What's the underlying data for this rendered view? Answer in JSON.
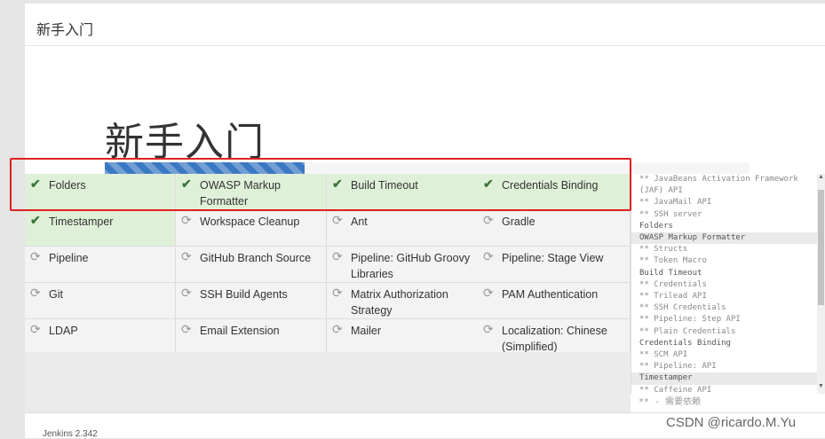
{
  "window": {
    "title": "新手入门"
  },
  "hero": {
    "title": "新手入门",
    "progress_fraction": 0.31
  },
  "plugins": [
    {
      "name": "Folders",
      "status": "done"
    },
    {
      "name": "OWASP Markup Formatter",
      "status": "done"
    },
    {
      "name": "Build Timeout",
      "status": "done"
    },
    {
      "name": "Credentials Binding",
      "status": "done"
    },
    {
      "name": "Timestamper",
      "status": "done"
    },
    {
      "name": "Workspace Cleanup",
      "status": "pending"
    },
    {
      "name": "Ant",
      "status": "pending"
    },
    {
      "name": "Gradle",
      "status": "pending"
    },
    {
      "name": "Pipeline",
      "status": "pending"
    },
    {
      "name": "GitHub Branch Source",
      "status": "pending"
    },
    {
      "name": "Pipeline: GitHub Groovy Libraries",
      "status": "pending"
    },
    {
      "name": "Pipeline: Stage View",
      "status": "pending"
    },
    {
      "name": "Git",
      "status": "pending"
    },
    {
      "name": "SSH Build Agents",
      "status": "pending"
    },
    {
      "name": "Matrix Authorization Strategy",
      "status": "pending"
    },
    {
      "name": "PAM Authentication",
      "status": "pending"
    },
    {
      "name": "LDAP",
      "status": "pending"
    },
    {
      "name": "Email Extension",
      "status": "pending"
    },
    {
      "name": "Mailer",
      "status": "pending"
    },
    {
      "name": "Localization: Chinese (Simplified)",
      "status": "pending"
    }
  ],
  "icons": {
    "done": "check-icon",
    "pending": "refresh-icon"
  },
  "log_lines": [
    {
      "text": "** JavaBeans Activation Framework",
      "dep": true
    },
    {
      "text": "(JAF) API",
      "dep": true
    },
    {
      "text": "** JavaMail API",
      "dep": true
    },
    {
      "text": "** SSH server",
      "dep": true
    },
    {
      "text": "Folders",
      "dep": false
    },
    {
      "text": "OWASP Markup Formatter",
      "dep": false,
      "highlight": true
    },
    {
      "text": "** Structs",
      "dep": true
    },
    {
      "text": "** Token Macro",
      "dep": true
    },
    {
      "text": "Build Timeout",
      "dep": false
    },
    {
      "text": "** Credentials",
      "dep": true
    },
    {
      "text": "** Trilead API",
      "dep": true
    },
    {
      "text": "** SSH Credentials",
      "dep": true
    },
    {
      "text": "** Pipeline: Step API",
      "dep": true
    },
    {
      "text": "** Plain Credentials",
      "dep": true
    },
    {
      "text": "Credentials Binding",
      "dep": false
    },
    {
      "text": "** SCM API",
      "dep": true
    },
    {
      "text": "** Pipeline: API",
      "dep": true
    },
    {
      "text": "Timestamper",
      "dep": false,
      "highlight": true
    },
    {
      "text": "** Caffeine API",
      "dep": true
    }
  ],
  "legend": "** - 需要依赖",
  "footer": "Jenkins 2.342",
  "watermark": "CSDN @ricardo.M.Yu",
  "colors": {
    "done_bg": "#dff0d8",
    "progress": "#3b78c4",
    "annotation": "#e02020"
  }
}
